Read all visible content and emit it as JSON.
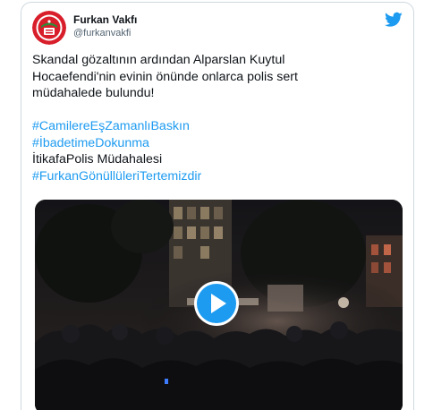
{
  "tweet": {
    "author": {
      "display_name": "Furkan Vakfı",
      "handle": "@furkanvakfi",
      "avatar_icon": "furkan-vakfi-logo"
    },
    "platform_icon": "twitter-bird-icon",
    "text_lines": [
      "Skandal gözaltının ardından Alparslan Kuytul",
      "Hocaefendi'nin evinin önünde onlarca polis sert",
      "müdahalede bulundu!"
    ],
    "hashtags": [
      "#CamilereEşZamanlıBaskın",
      "#İbadetimeDokunma"
    ],
    "plain_line": "İtikafaPolis Müdahalesi",
    "last_hashtag": "#FurkanGönüllüleriTertemizdir",
    "media": {
      "type": "video",
      "play_icon": "play-icon"
    }
  },
  "colors": {
    "accent": "#1d9bf0",
    "text": "#0f1419",
    "secondary": "#536471",
    "border": "#cfd9de",
    "logo_red": "#d81e2a",
    "logo_green": "#2e8b3a"
  }
}
